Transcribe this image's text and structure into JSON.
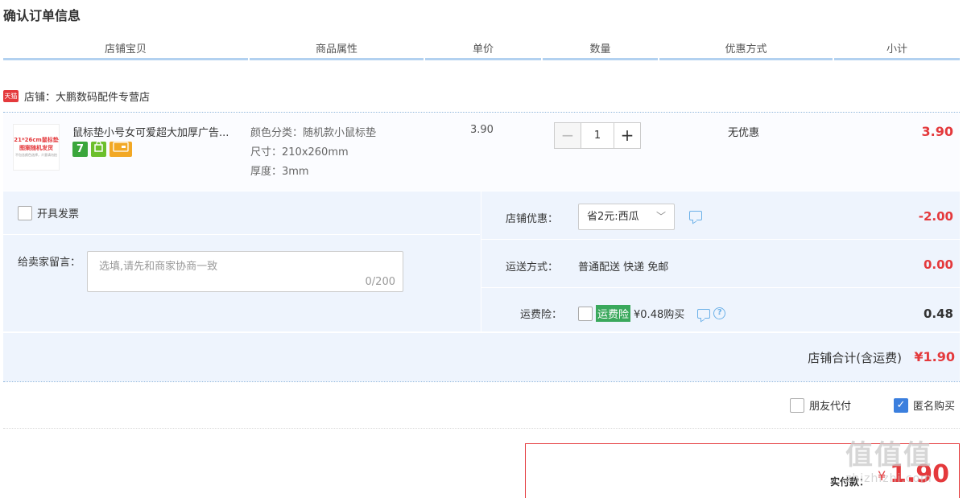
{
  "page_title": "确认订单信息",
  "columns": [
    "店铺宝贝",
    "商品属性",
    "单价",
    "数量",
    "优惠方式",
    "小计"
  ],
  "shop": {
    "badge": "天猫",
    "label": "店铺：大鹏数码配件专营店"
  },
  "item": {
    "thumb_line1": "21*26cm鼠标垫",
    "thumb_line2": "图案随机发货",
    "thumb_line3": "不包含颜色选择，介意请勿拍",
    "title": "鼠标垫小号女可爱超大加厚广告...",
    "icon_seven": "7",
    "attrs": [
      "颜色分类：随机款小鼠标垫",
      "尺寸：210x260mm",
      "厚度：3mm"
    ],
    "price": "3.90",
    "qty_minus": "−",
    "qty_value": "1",
    "qty_plus": "+",
    "discount": "无优惠",
    "subtotal": "3.90"
  },
  "options": {
    "invoice_label": "开具发票",
    "message_label": "给卖家留言：",
    "message_placeholder": "选填,请先和商家协商一致",
    "message_count": "0/200",
    "shop_discount_label": "店铺优惠：",
    "shop_discount_value": "省2元:西瓜",
    "shop_discount_amount": "-2.00",
    "shipping_label": "运送方式：",
    "shipping_value": "普通配送 快递 免邮",
    "shipping_amount": "0.00",
    "insurance_label": "运费险：",
    "insurance_badge": "运费险",
    "insurance_text": "¥0.48购买",
    "insurance_amount": "0.48"
  },
  "total": {
    "label": "店铺合计(含运费)",
    "amount": "¥1.90"
  },
  "friend_pay": "朋友代付",
  "anonymous": "匿名购买",
  "pay": {
    "label": "实付款：",
    "currency": "¥",
    "amount": "1.90"
  },
  "watermark": {
    "logo": "值值值",
    "url": "zhizhizhi.com"
  }
}
